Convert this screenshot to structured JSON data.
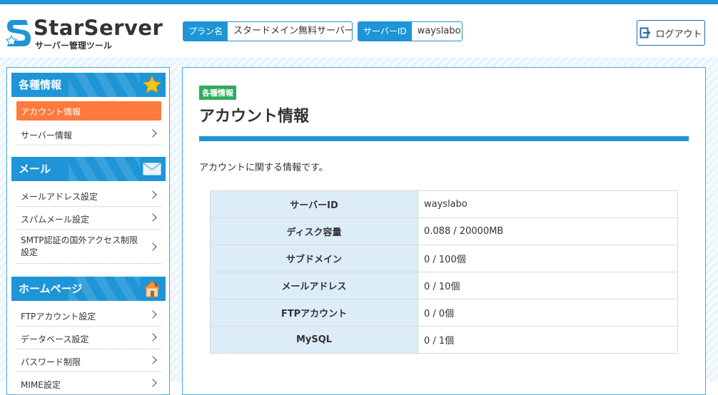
{
  "app": {
    "title": "StarServer",
    "subtitle": "サーバー管理ツール"
  },
  "header": {
    "plan_label": "プラン名",
    "plan_value": "スタードメイン無料サーバー",
    "server_id_label": "サーバーID",
    "server_id_value": "wayslabo",
    "logout_label": "ログアウト"
  },
  "sidebar": {
    "sections": [
      {
        "title": "各種情報",
        "icon": "star-icon",
        "items": [
          {
            "label": "アカウント情報",
            "active": true
          },
          {
            "label": "サーバー情報"
          }
        ]
      },
      {
        "title": "メール",
        "icon": "envelope-icon",
        "items": [
          {
            "label": "メールアドレス設定"
          },
          {
            "label": "スパムメール設定"
          },
          {
            "label": "SMTP認証の国外アクセス制限設定"
          }
        ]
      },
      {
        "title": "ホームページ",
        "icon": "house-icon",
        "items": [
          {
            "label": "FTPアカウント設定"
          },
          {
            "label": "データベース設定"
          },
          {
            "label": "パスワード制限"
          },
          {
            "label": "MIME設定"
          }
        ]
      }
    ]
  },
  "main": {
    "badge": "各種情報",
    "title": "アカウント情報",
    "intro": "アカウントに関する情報です。",
    "rows": [
      {
        "label": "サーバーID",
        "value": "wayslabo"
      },
      {
        "label": "ディスク容量",
        "value": "0.088 / 20000MB"
      },
      {
        "label": "サブドメイン",
        "value": "0 / 100個"
      },
      {
        "label": "メールアドレス",
        "value": "0 / 10個"
      },
      {
        "label": "FTPアカウント",
        "value": "0 / 0個"
      },
      {
        "label": "MySQL",
        "value": "0 / 1個"
      }
    ]
  },
  "colors": {
    "accent": "#1e95d6",
    "active": "#ff7a3d",
    "badge": "#2eab5d"
  }
}
